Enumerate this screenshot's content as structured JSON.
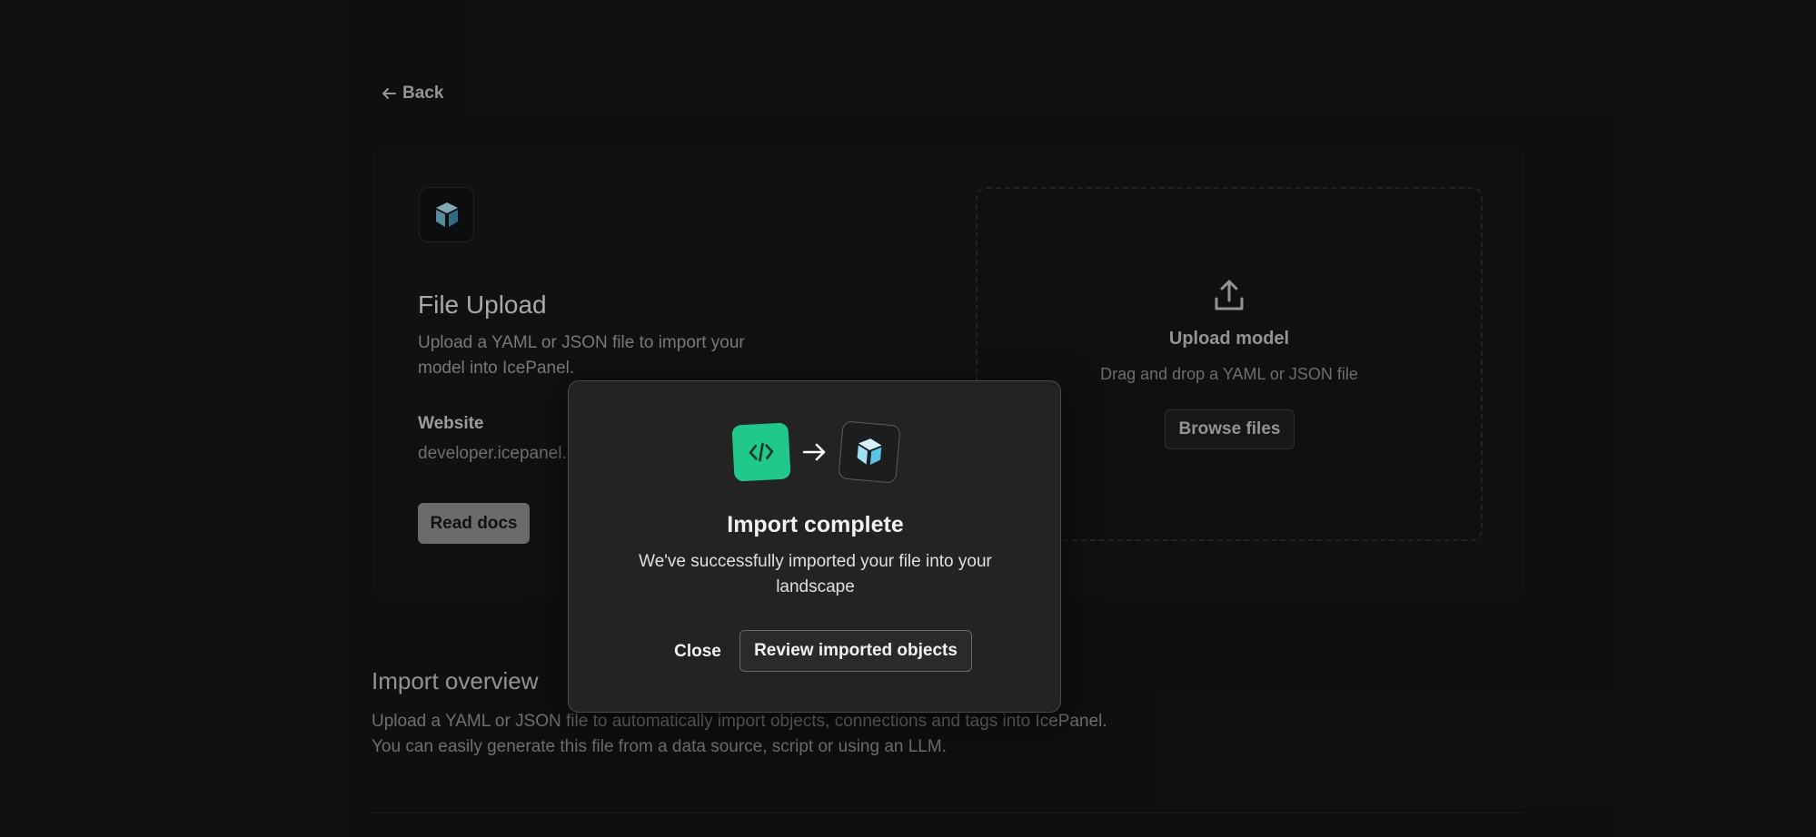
{
  "nav": {
    "back_label": "Back",
    "back_icon": "arrow-left-icon"
  },
  "file_upload": {
    "logo_icon": "icepanel-cube-icon",
    "title": "File Upload",
    "description": "Upload a YAML or JSON file to import your model into IcePanel.",
    "website_label": "Website",
    "website_value": "developer.icepanel.io",
    "read_docs_label": "Read docs"
  },
  "drop_zone": {
    "icon": "upload-icon",
    "title": "Upload model",
    "subtitle": "Drag and drop a YAML or JSON file",
    "browse_label": "Browse files"
  },
  "overview": {
    "title": "Import overview",
    "line1": "Upload a YAML or JSON file to automatically import objects, connections and tags into IcePanel.",
    "line2": "You can easily generate this file from a data source, script or using an LLM."
  },
  "modal": {
    "source_icon": "code-icon",
    "arrow_icon": "arrow-right-icon",
    "target_icon": "icepanel-cube-icon",
    "title": "Import complete",
    "description": "We've successfully imported your file into your landscape",
    "close_label": "Close",
    "review_label": "Review imported objects"
  },
  "colors": {
    "accent_green": "#20c98a",
    "cube_blue": "#8fd8f5",
    "background": "#141414",
    "modal_bg": "#232323"
  }
}
